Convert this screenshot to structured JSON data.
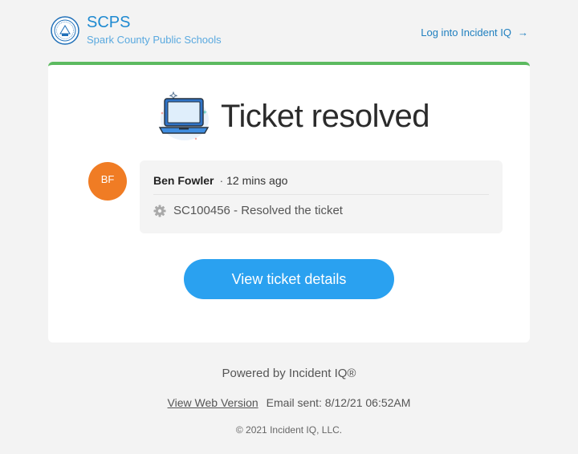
{
  "header": {
    "logo_icon": "district-seal-icon",
    "brand_title": "SCPS",
    "brand_subtitle": "Spark County Public Schools",
    "login_link": "Log into Incident IQ",
    "login_arrow": "→"
  },
  "card": {
    "accent_color": "#5cba60",
    "hero_icon": "laptop-icon",
    "title": "Ticket resolved",
    "activity": {
      "avatar_initials": "BF",
      "avatar_color": "#f07c24",
      "user_name": "Ben Fowler",
      "separator": "·",
      "time_ago": "12 mins ago",
      "status_icon": "gear-icon",
      "message": "SC100456 - Resolved the ticket"
    },
    "cta_label": "View ticket details",
    "cta_color": "#2aa1f0"
  },
  "footer": {
    "powered_by": "Powered by Incident IQ®",
    "web_version": "View Web Version",
    "email_sent": "Email sent: 8/12/21 06:52AM",
    "copyright": "© 2021 Incident IQ, LLC."
  }
}
